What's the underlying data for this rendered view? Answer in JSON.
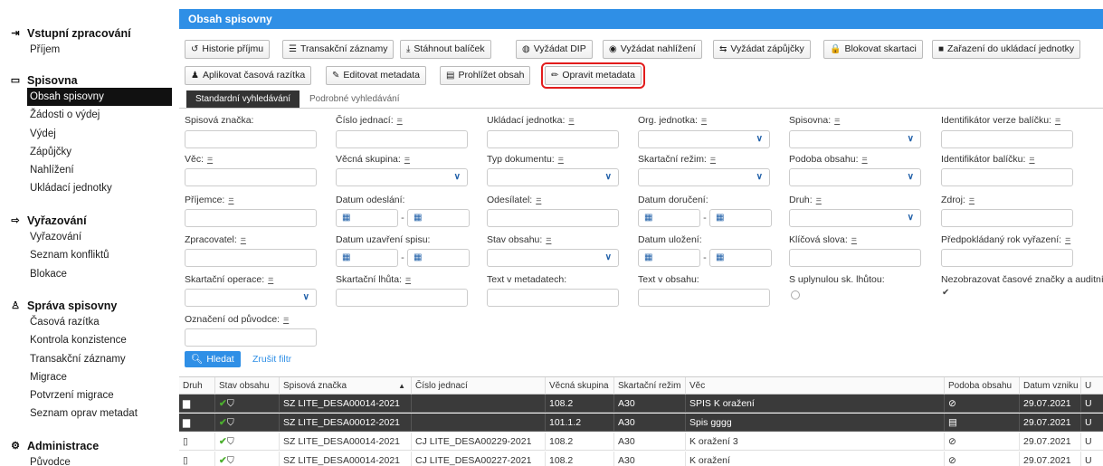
{
  "sidebar": {
    "sections": [
      {
        "title": "Vstupní zpracování",
        "icon": "input-icon",
        "items": [
          "Příjem"
        ]
      },
      {
        "title": "Spisovna",
        "icon": "folder-icon",
        "items": [
          "Obsah spisovny",
          "Žádosti o výdej",
          "Výdej",
          "Zápůjčky",
          "Nahlížení",
          "Ukládací jednotky"
        ]
      },
      {
        "title": "Vyřazování",
        "icon": "discard-icon",
        "items": [
          "Vyřazování",
          "Seznam konfliktů",
          "Blokace"
        ]
      },
      {
        "title": "Správa spisovny",
        "icon": "admin-users-icon",
        "items": [
          "Časová razítka",
          "Kontrola konzistence",
          "Transakční záznamy",
          "Migrace",
          "Potvrzení migrace",
          "Seznam oprav metadat"
        ]
      },
      {
        "title": "Administrace",
        "icon": "gear-icon",
        "items": [
          "Původce"
        ]
      }
    ],
    "active_item": "Obsah spisovny"
  },
  "main": {
    "title": "Obsah spisovny",
    "toolbar_row1": [
      {
        "label": "Historie příjmu",
        "icon": "history-icon"
      },
      {
        "label": "Transakční záznamy",
        "icon": "list-icon"
      },
      {
        "label": "Stáhnout balíček",
        "icon": "download-icon"
      },
      {
        "label": "Vyžádat DIP",
        "icon": "shield-icon"
      },
      {
        "label": "Vyžádat nahlížení",
        "icon": "eye-icon"
      },
      {
        "label": "Vyžádat zápůjčky",
        "icon": "exchange-icon"
      },
      {
        "label": "Blokovat skartaci",
        "icon": "lock-icon"
      },
      {
        "label": "Zařazení do ukládací jednotky",
        "icon": "box-icon"
      }
    ],
    "toolbar_row2": [
      {
        "label": "Aplikovat časová razítka",
        "icon": "stamp-icon"
      },
      {
        "label": "Editovat metadata",
        "icon": "edit-icon"
      },
      {
        "label": "Prohlížet obsah",
        "icon": "monitor-icon"
      },
      {
        "label": "Opravit metadata",
        "icon": "pencil-icon",
        "highlighted": true
      }
    ],
    "tabs": [
      "Standardní vyhledávání",
      "Podrobné vyhledávání"
    ],
    "active_tab": "Standardní vyhledávání",
    "filters": {
      "spisova_znacka": "Spisová značka:",
      "cislo_jednaci": "Číslo jednací:",
      "ukladaci_jednotka": "Ukládací jednotka:",
      "org_jednotka": "Org. jednotka:",
      "spisovna": "Spisovna:",
      "id_verze_balicku": "Identifikátor verze balíčku:",
      "vec": "Věc:",
      "vecna_skupina": "Věcná skupina:",
      "typ_dokumentu": "Typ dokumentu:",
      "skartacni_rezim": "Skartační režim:",
      "podoba_obsahu": "Podoba obsahu:",
      "id_balicku": "Identifikátor balíčku:",
      "prijemce": "Příjemce:",
      "datum_odeslani": "Datum odeslání:",
      "odesilatel": "Odesílatel:",
      "datum_doruceni": "Datum doručení:",
      "druh": "Druh:",
      "zdroj": "Zdroj:",
      "zpracovatel": "Zpracovatel:",
      "datum_uzavreni": "Datum uzavření spisu:",
      "stav_obsahu": "Stav obsahu:",
      "datum_ulozeni": "Datum uložení:",
      "klicova_slova": "Klíčová slova:",
      "predpokladany_rok": "Předpokládaný rok vyřazení:",
      "skartacni_operace": "Skartační operace:",
      "skartacni_lhuta": "Skartační lhůta:",
      "text_metadata": "Text v metadatech:",
      "text_obsah": "Text v obsahu:",
      "uplynulou": "S uplynulou sk. lhůtou:",
      "nezobrazovat": "Nezobrazovat časové značky a auditní",
      "oznaceni_puvodce": "Označení od původce:",
      "eq": "="
    },
    "search_label": "Hledat",
    "reset_label": "Zrušit filtr",
    "table": {
      "columns": [
        "Druh",
        "Stav obsahu",
        "Spisová značka",
        "Číslo jednací",
        "Věcná skupina",
        "Skartační režim",
        "Věc",
        "Podoba obsahu",
        "Datum vzniku",
        "U"
      ],
      "rows": [
        {
          "druh": "folder",
          "spisova_znacka": "SZ LITE_DESA00014-2021",
          "cislo_jednaci": "",
          "vecna_skupina": "108.2",
          "skartacni_rezim": "A30",
          "vec": "SPIS K oražení",
          "podoba": "digital",
          "datum": "29.07.2021",
          "u": "U",
          "selected": true
        },
        {
          "druh": "folder",
          "spisova_znacka": "SZ LITE_DESA00012-2021",
          "cislo_jednaci": "",
          "vecna_skupina": "101.1.2",
          "skartacni_rezim": "A30",
          "vec": "Spis gggg",
          "podoba": "paper",
          "datum": "29.07.2021",
          "u": "U",
          "selected": true
        },
        {
          "druh": "document",
          "spisova_znacka": "SZ LITE_DESA00014-2021",
          "cislo_jednaci": "CJ LITE_DESA00229-2021",
          "vecna_skupina": "108.2",
          "skartacni_rezim": "A30",
          "vec": "K oražení 3",
          "podoba": "digital",
          "datum": "29.07.2021",
          "u": "U",
          "selected": false
        },
        {
          "druh": "document",
          "spisova_znacka": "SZ LITE_DESA00014-2021",
          "cislo_jednaci": "CJ LITE_DESA00227-2021",
          "vecna_skupina": "108.2",
          "skartacni_rezim": "A30",
          "vec": "K oražení",
          "podoba": "digital",
          "datum": "29.07.2021",
          "u": "U",
          "selected": false
        }
      ]
    }
  }
}
